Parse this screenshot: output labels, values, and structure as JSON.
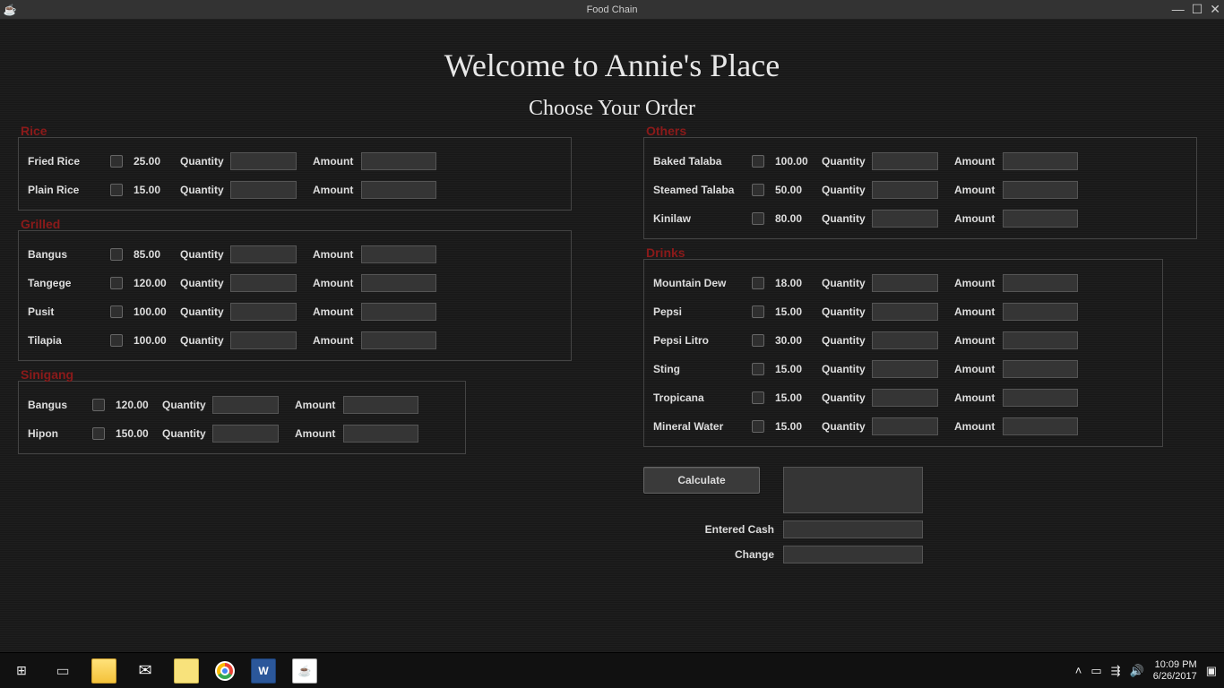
{
  "window": {
    "title": "Food Chain"
  },
  "header": {
    "welcome": "Welcome to Annie's Place",
    "subtitle": "Choose Your Order"
  },
  "labels": {
    "quantity": "Quantity",
    "amount": "Amount"
  },
  "sections": {
    "rice": {
      "title": "Rice",
      "items": [
        {
          "name": "Fried Rice",
          "price": "25.00"
        },
        {
          "name": "Plain Rice",
          "price": "15.00"
        }
      ]
    },
    "grilled": {
      "title": "Grilled",
      "items": [
        {
          "name": "Bangus",
          "price": "85.00"
        },
        {
          "name": "Tangege",
          "price": "120.00"
        },
        {
          "name": "Pusit",
          "price": "100.00"
        },
        {
          "name": "Tilapia",
          "price": "100.00"
        }
      ]
    },
    "sinigang": {
      "title": "Sinigang",
      "items": [
        {
          "name": "Bangus",
          "price": "120.00"
        },
        {
          "name": "Hipon",
          "price": "150.00"
        }
      ]
    },
    "others": {
      "title": "Others",
      "items": [
        {
          "name": "Baked Talaba",
          "price": "100.00"
        },
        {
          "name": "Steamed Talaba",
          "price": "50.00"
        },
        {
          "name": "Kinilaw",
          "price": "80.00"
        }
      ]
    },
    "drinks": {
      "title": "Drinks",
      "items": [
        {
          "name": "Mountain Dew",
          "price": "18.00"
        },
        {
          "name": "Pepsi",
          "price": "15.00"
        },
        {
          "name": "Pepsi Litro",
          "price": "30.00"
        },
        {
          "name": "Sting",
          "price": "15.00"
        },
        {
          "name": "Tropicana",
          "price": "15.00"
        },
        {
          "name": "Mineral Water",
          "price": "15.00"
        }
      ]
    }
  },
  "actions": {
    "calculate": "Calculate",
    "entered_cash": "Entered Cash",
    "change": "Change"
  },
  "taskbar": {
    "time": "10:09 PM",
    "date": "6/26/2017"
  }
}
